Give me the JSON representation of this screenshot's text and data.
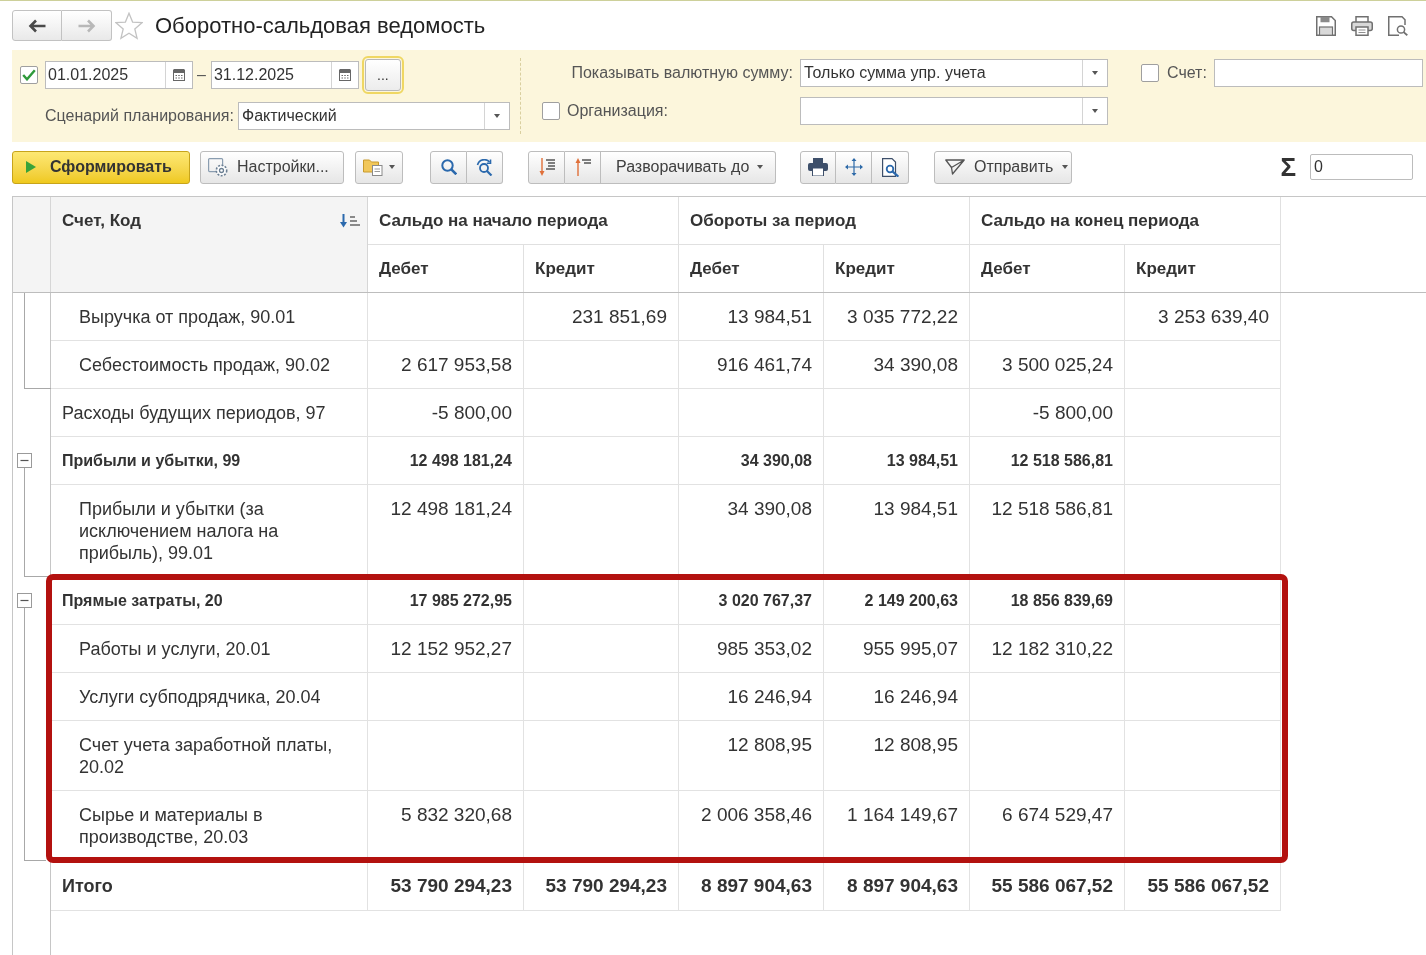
{
  "window": {
    "title": "Оборотно-сальдовая ведомость",
    "favorite": false
  },
  "navigation": {
    "back": {
      "disabled": false
    },
    "forward": {
      "disabled": true
    }
  },
  "filters": {
    "period": {
      "checked": true,
      "from": "01.01.2025",
      "separator": "–",
      "to": "31.12.2025",
      "more_button": {
        "label": "...",
        "focused": true
      }
    },
    "scenario": {
      "label": "Сценарий планирования:",
      "value": "Фактический"
    },
    "currency": {
      "label": "Показывать валютную сумму:",
      "value": "Только сумма упр. учета"
    },
    "organization": {
      "label": "Организация:",
      "checked": false
    },
    "account": {
      "label": "Счет:",
      "checked": false
    }
  },
  "toolbar": {
    "generate_button": {
      "label": "Сформировать"
    },
    "settings_button": {
      "label": "Настройки..."
    },
    "expand_menu": {
      "label": "Разворачивать до"
    },
    "send_menu": {
      "label": "Отправить"
    },
    "sum": {
      "symbol": "Σ",
      "value": "0"
    }
  },
  "table": {
    "account_column": {
      "label": "Счет, Код"
    },
    "column_groups": [
      {
        "title": "Сальдо на начало периода",
        "columns": [
          "Дебет",
          "Кредит"
        ]
      },
      {
        "title": "Обороты за период",
        "columns": [
          "Дебет",
          "Кредит"
        ]
      },
      {
        "title": "Сальдо на конец периода",
        "columns": [
          "Дебет",
          "Кредит"
        ]
      }
    ],
    "rows": [
      {
        "kind": "continued",
        "children": [
          {
            "account": "Выручка от продаж, 90.01",
            "values": {
              "opening_credit": "231 851,69",
              "turnover_debit": "13 984,51",
              "turnover_credit": "3 035 772,22",
              "closing_credit": "3 253 639,40"
            }
          },
          {
            "account": "Себестоимость продаж, 90.02",
            "values": {
              "opening_debit": "2 617 953,58",
              "turnover_debit": "916 461,74",
              "turnover_credit": "34 390,08",
              "closing_debit": "3 500 025,24"
            }
          }
        ]
      },
      {
        "kind": "account",
        "account": "Расходы будущих периодов, 97",
        "values": {
          "opening_debit": "-5 800,00",
          "closing_debit": "-5 800,00"
        }
      },
      {
        "kind": "group",
        "account": "Прибыли и убытки, 99",
        "expanded": true,
        "values": {
          "opening_debit": "12 498 181,24",
          "turnover_debit": "34 390,08",
          "turnover_credit": "13 984,51",
          "closing_debit": "12 518 586,81"
        },
        "children": [
          {
            "account": "Прибыли и убытки (за исключением налога на прибыль), 99.01",
            "values": {
              "opening_debit": "12 498 181,24",
              "turnover_debit": "34 390,08",
              "turnover_credit": "13 984,51",
              "closing_debit": "12 518 586,81"
            }
          }
        ]
      },
      {
        "kind": "group",
        "account": "Прямые затраты, 20",
        "expanded": true,
        "highlighted": true,
        "values": {
          "opening_debit": "17 985 272,95",
          "turnover_debit": "3 020 767,37",
          "turnover_credit": "2 149 200,63",
          "closing_debit": "18 856 839,69"
        },
        "children": [
          {
            "account": "Работы и услуги, 20.01",
            "values": {
              "opening_debit": "12 152 952,27",
              "turnover_debit": "985 353,02",
              "turnover_credit": "955 995,07",
              "closing_debit": "12 182 310,22"
            }
          },
          {
            "account": "Услуги субподрядчика, 20.04",
            "values": {
              "turnover_debit": "16 246,94",
              "turnover_credit": "16 246,94"
            }
          },
          {
            "account": "Счет учета заработной платы, 20.02",
            "values": {
              "turnover_debit": "12 808,95",
              "turnover_credit": "12 808,95"
            }
          },
          {
            "account": "Сырье и материалы в производстве, 20.03",
            "values": {
              "opening_debit": "5 832 320,68",
              "turnover_debit": "2 006 358,46",
              "turnover_credit": "1 164 149,67",
              "closing_debit": "6 674 529,47"
            }
          }
        ]
      }
    ],
    "total": {
      "account": "Итого",
      "values": {
        "opening_debit": "53 790 294,23",
        "opening_credit": "53 790 294,23",
        "turnover_debit": "8 897 904,63",
        "turnover_credit": "8 897 904,63",
        "closing_debit": "55 586 067,52",
        "closing_credit": "55 586 067,52"
      }
    }
  }
}
